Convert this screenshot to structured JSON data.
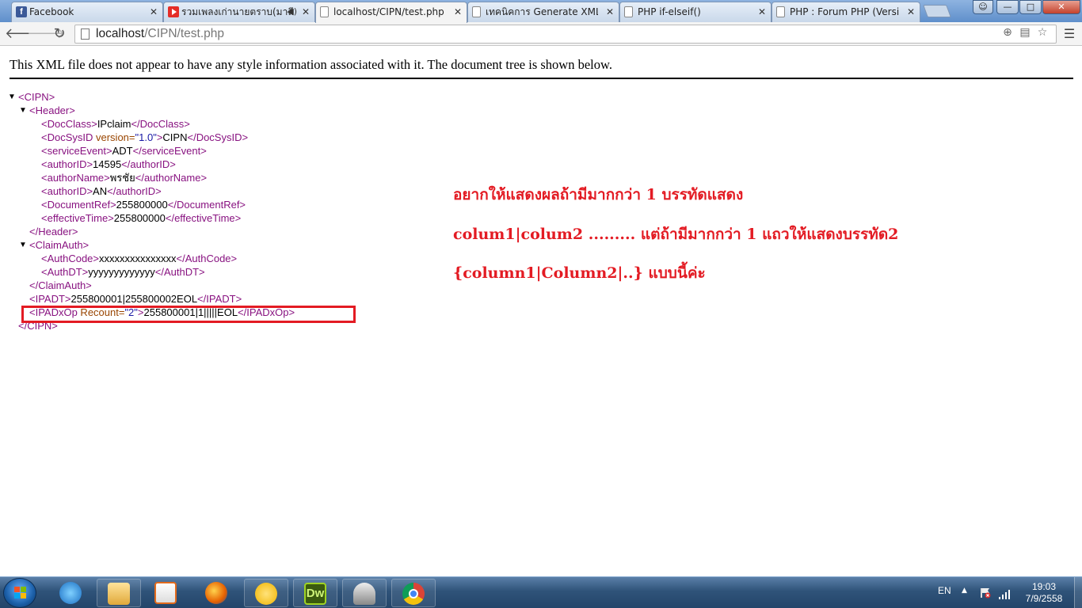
{
  "tabs": [
    {
      "title": "Facebook",
      "icon": "facebook-icon"
    },
    {
      "title": "รวมเพลงเก่านายตราบ(มาลี",
      "icon": "youtube-icon"
    },
    {
      "title": "localhost/CIPN/test.php",
      "icon": "page-icon",
      "active": true
    },
    {
      "title": "เทคนิคการ Generate XML ดี",
      "icon": "page-icon"
    },
    {
      "title": "PHP if-elseif()",
      "icon": "page-icon"
    },
    {
      "title": "PHP : Forum PHP (Version",
      "icon": "page-icon"
    }
  ],
  "window_controls": {
    "minimize": "—",
    "maximize": "□",
    "close": "✕"
  },
  "address": {
    "host": "localhost",
    "path": "/CIPN/test.php"
  },
  "page": {
    "notice": "This XML file does not appear to have any style information associated with it. The document tree is shown below."
  },
  "xml": {
    "cipn_open": "<CIPN>",
    "header_open": "<Header>",
    "docclass": {
      "open": "<DocClass>",
      "text": "IPclaim",
      "close": "</DocClass>"
    },
    "docsysid": {
      "open": "<DocSysID",
      "attr_name": " version=",
      "attr_value": "\"1.0\"",
      "open_end": ">",
      "text": "CIPN",
      "close": "</DocSysID>"
    },
    "serviceevent": {
      "open": "<serviceEvent>",
      "text": "ADT",
      "close": "</serviceEvent>"
    },
    "authorid": {
      "open": "<authorID>",
      "text": "14595",
      "close": "</authorID>"
    },
    "authorname": {
      "open": "<authorName>",
      "text": "พรชัย",
      "close": "</authorName>"
    },
    "authorid2": {
      "open": "<authorID>",
      "text": "AN",
      "close": "</authorID>"
    },
    "documentref": {
      "open": "<DocumentRef>",
      "text": "255800000",
      "close": "</DocumentRef>"
    },
    "effectivetime": {
      "open": "<effectiveTime>",
      "text": "255800000",
      "close": "</effectiveTime>"
    },
    "header_close": "</Header>",
    "claimauth_open": "<ClaimAuth>",
    "authcode": {
      "open": "<AuthCode>",
      "text": "xxxxxxxxxxxxxxx",
      "close": "</AuthCode>"
    },
    "authdt": {
      "open": "<AuthDT>",
      "text": "yyyyyyyyyyyyy",
      "close": "</AuthDT>"
    },
    "claimauth_close": "</ClaimAuth>",
    "ipadt": {
      "open": "<IPADT>",
      "text": "255800001|255800002EOL",
      "close": "</IPADT>"
    },
    "ipadxop": {
      "open": "<IPADxOp",
      "attr_name": " Recount=",
      "attr_value": "\"2\"",
      "open_end": ">",
      "text": "255800001|1|||||EOL",
      "close": "</IPADxOp>"
    },
    "cipn_close": "</CIPN>"
  },
  "annotation": {
    "line1": "อยากให้แสดงผลถ้ามีมากกว่า 1 บรรทัดแสดง",
    "line2": "colum1|colum2  .........  แต่ถ้ามีมากกว่า 1 แถวให้แสดงบรรทัด2",
    "line3": "{column1|Column2|..} แบบนี้ค่ะ",
    "color": "#e31b23"
  },
  "taskbar": {
    "apps": [
      "internet-explorer-icon",
      "file-explorer-icon",
      "media-player-icon",
      "firefox-icon",
      "messenger-icon",
      "dreamweaver-icon",
      "scanner-icon",
      "chrome-icon"
    ],
    "dw_label": "Dw",
    "language": "EN",
    "time": "19:03",
    "date": "7/9/2558"
  }
}
